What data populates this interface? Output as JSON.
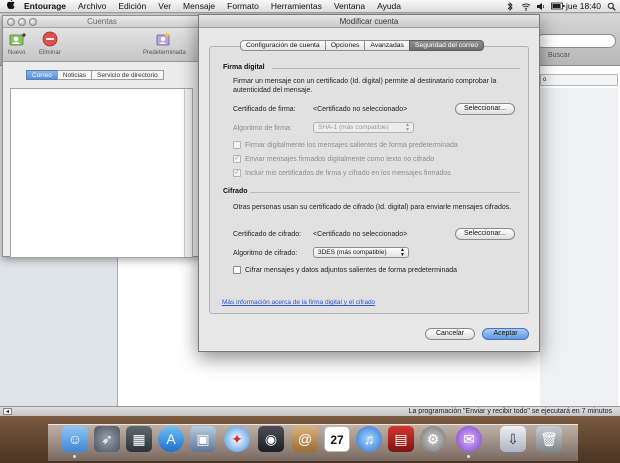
{
  "menubar": {
    "apple": "",
    "items": [
      "Entourage",
      "Archivo",
      "Edición",
      "Ver",
      "Mensaje",
      "Formato",
      "Herramientas",
      "Ventana",
      "Ayuda"
    ],
    "clock": "jue 18:40"
  },
  "background": {
    "search_hint": "Buscar",
    "status": "La programación \"Enviar y recibir todo\" se ejecutará en 7 minutos"
  },
  "accounts_window": {
    "title": "Cuentas",
    "toolbar": [
      {
        "label": "Nuevo",
        "icon": "new-account-icon"
      },
      {
        "label": "Eliminar",
        "icon": "delete-icon"
      },
      {
        "label": "Predeterminada",
        "icon": "default-account-icon"
      }
    ],
    "tabs": [
      "Correo",
      "Noticias",
      "Servicio de directorio"
    ],
    "selected_tab": "Correo"
  },
  "dialog": {
    "title": "Modificar cuenta",
    "tabs": [
      "Configuración de cuenta",
      "Opciones",
      "Avanzadas",
      "Seguridad del correo"
    ],
    "selected_tab": "Seguridad del correo",
    "signing": {
      "title": "Firma digital",
      "description": "Firmar un mensaje con un certificado (Id. digital) permite al destinatario comprobar la autenticidad del mensaje.",
      "cert_label": "Certificado de firma:",
      "cert_value": "<Certificado no seleccionado>",
      "select_button": "Seleccionar...",
      "algorithm_label": "Algoritmo de firma:",
      "algorithm_value": "SHA-1 (más compatible)",
      "checkboxes": [
        {
          "label": "Firmar digitalmente los mensajes salientes de forma predeterminada",
          "checked": false
        },
        {
          "label": "Enviar mensajes firmados digitalmente como texto no cifrado",
          "checked": true
        },
        {
          "label": "Incluir mis certificados de firma y cifrado en los mensajes firmados",
          "checked": true
        }
      ]
    },
    "encryption": {
      "title": "Cifrado",
      "description": "Otras personas usan su certificado de cifrado (Id. digital) para enviarle mensajes cifrados.",
      "cert_label": "Certificado de cifrado:",
      "cert_value": "<Certificado no seleccionado>",
      "select_button": "Seleccionar...",
      "algorithm_label": "Algoritmo de cifrado:",
      "algorithm_value": "3DES (más compatible)",
      "checkbox": {
        "label": "Cifrar mensajes y datos adjuntos salientes de forma predeterminada",
        "checked": false
      }
    },
    "more_info_link": "Más información acerca de la firma digital y el cifrado",
    "cancel_button": "Cancelar",
    "accept_button": "Aceptar"
  },
  "dock": {
    "icons": [
      "finder-icon",
      "rocket-icon",
      "calculator-icon",
      "app-store-icon",
      "preview-icon",
      "safari-icon",
      "facetime-icon",
      "address-book-icon",
      "calendar-icon",
      "itunes-icon",
      "photo-booth-icon",
      "system-preferences-icon",
      "entourage-icon",
      "downloads-stack-icon",
      "trash-icon"
    ],
    "calendar_day": "27"
  }
}
